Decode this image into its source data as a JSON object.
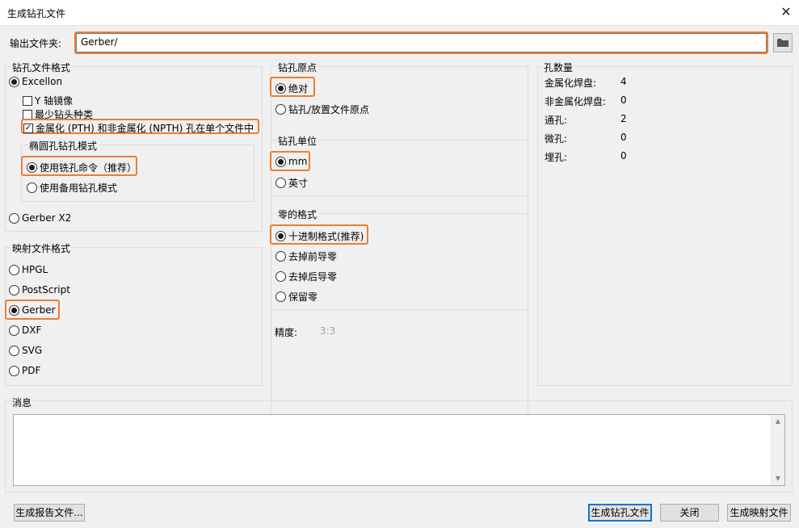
{
  "window": {
    "title": "生成钻孔文件",
    "close_symbol": "✕"
  },
  "output": {
    "label": "输出文件夹:",
    "value": "Gerber/",
    "browse_icon": "folder-icon"
  },
  "drill_format": {
    "title": "钻孔文件格式",
    "excellon": "Excellon",
    "y_mirror": "Y 轴镜像",
    "min_header": "最少钻头种类",
    "merge_pth": "金属化 (PTH) 和非金属化 (NPTH) 孔在单个文件中",
    "oval_title": "椭圆孔钻孔模式",
    "use_route": "使用铣孔命令（推荐）",
    "use_alt": "使用备用钻孔模式",
    "gerber_x2": "Gerber X2"
  },
  "map_format": {
    "title": "映射文件格式",
    "options": [
      "HPGL",
      "PostScript",
      "Gerber",
      "DXF",
      "SVG",
      "PDF"
    ]
  },
  "drill_origin": {
    "title": "钻孔原点",
    "absolute": "绝对",
    "aux": "钻孔/放置文件原点"
  },
  "drill_units": {
    "title": "钻孔单位",
    "mm": "mm",
    "inch": "英寸"
  },
  "zeros_format": {
    "title": "零的格式",
    "decimal": "十进制格式(推荐)",
    "suppress_leading": "去掉前导零",
    "suppress_trailing": "去掉后导零",
    "keep": "保留零"
  },
  "precision": {
    "label": "精度:",
    "value": "3:3"
  },
  "hole_counts": {
    "title": "孔数量",
    "rows": [
      {
        "label": "金属化焊盘:",
        "value": "4"
      },
      {
        "label": "非金属化焊盘:",
        "value": "0"
      },
      {
        "label": "通孔:",
        "value": "2"
      },
      {
        "label": "微孔:",
        "value": "0"
      },
      {
        "label": "埋孔:",
        "value": "0"
      }
    ]
  },
  "messages": {
    "title": "消息",
    "content": ""
  },
  "buttons": {
    "report": "生成报告文件...",
    "generate_drill": "生成钻孔文件",
    "close": "关闭",
    "generate_map": "生成映射文件"
  },
  "colors": {
    "highlight": "#ed7d31",
    "default_button": "#0078d7"
  }
}
